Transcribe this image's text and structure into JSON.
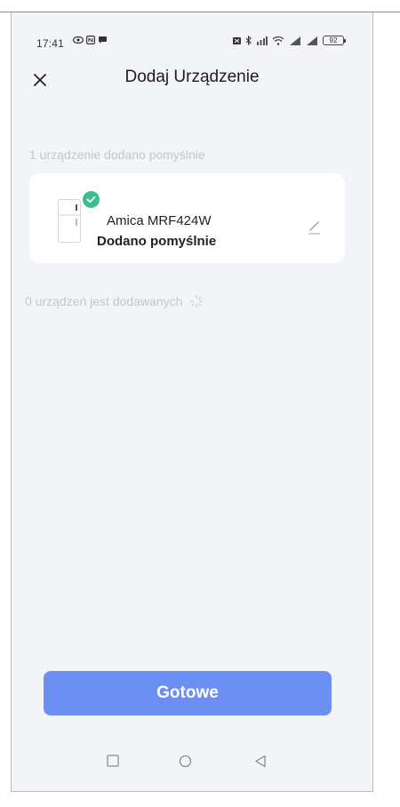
{
  "status_bar": {
    "time": "17:41",
    "battery": "92"
  },
  "header": {
    "title": "Dodaj Urządzenie"
  },
  "added_section": {
    "label": "1 urządzenie dodano pomyślnie"
  },
  "device": {
    "name": "Amica MRF424W",
    "status": "Dodano pomyślnie",
    "icon": "fridge-icon"
  },
  "adding_section": {
    "label": "0 urządzeń jest dodawanych"
  },
  "actions": {
    "done_label": "Gotowe"
  },
  "colors": {
    "accent": "#6b8ff3",
    "success": "#3bbf8f",
    "background": "#f3f4f8"
  }
}
